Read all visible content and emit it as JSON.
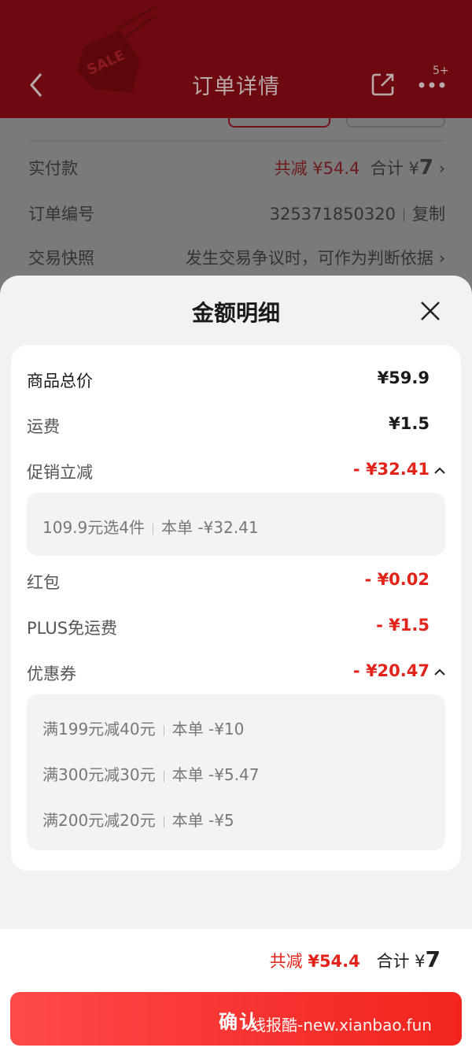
{
  "header": {
    "title": "订单详情",
    "more_badge": "5+",
    "sale_tag_text": "SALE"
  },
  "background_rows": {
    "paid": {
      "label": "实付款",
      "reduced": "共减 ¥54.4",
      "total_label": "合计",
      "currency": "¥",
      "total": "7"
    },
    "order_no": {
      "label": "订单编号",
      "value": "325371850320",
      "copy": "复制"
    },
    "snapshot": {
      "label": "交易快照",
      "value": "发生交易争议时，可作为判断依据"
    }
  },
  "sheet": {
    "title": "金额明细",
    "rows": {
      "goods_total": {
        "label": "商品总价",
        "value": "¥59.9"
      },
      "shipping": {
        "label": "运费",
        "value": "¥1.5"
      },
      "promo": {
        "label": "促销立减",
        "value": "- ¥32.41"
      },
      "redpacket": {
        "label": "红包",
        "value": "- ¥0.02"
      },
      "plus": {
        "label": "PLUS免运费",
        "value": "- ¥1.5"
      },
      "coupon": {
        "label": "优惠券",
        "value": "- ¥20.47"
      }
    },
    "promo_details": [
      {
        "rule": "109.9元选4件",
        "amount": "本单 -¥32.41"
      }
    ],
    "coupon_details": [
      {
        "rule": "满199元减40元",
        "amount": "本单 -¥10"
      },
      {
        "rule": "满300元减30元",
        "amount": "本单 -¥5.47"
      },
      {
        "rule": "满200元减20元",
        "amount": "本单 -¥5"
      }
    ]
  },
  "footer": {
    "reduced_label": "共减",
    "reduced_value": "¥54.4",
    "total_label": "合计",
    "currency": "¥",
    "total_value": "7",
    "confirm_label": "确认",
    "watermark": "线报酷-new.xianbao.fun"
  },
  "colors": {
    "accent_red": "#e2231a",
    "header_bg": "#6f0910",
    "sheet_bg": "#f2f2f2"
  }
}
